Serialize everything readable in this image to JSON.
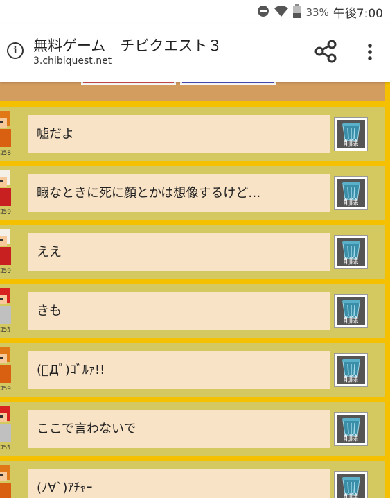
{
  "status_bar": {
    "battery": "33%",
    "time": "午後7:00"
  },
  "browser": {
    "title": "無料ゲーム　チビクエスト３",
    "url": "3.chibiquest.net"
  },
  "rows": [
    {
      "text": "嘘だよ",
      "avatar": "orange",
      "num": "ｺ58"
    },
    {
      "text": "暇なときに死に顔とかは想像するけど…",
      "avatar": "white",
      "num": "ｺ59"
    },
    {
      "text": "ええ",
      "avatar": "white",
      "num": "ｺ59"
    },
    {
      "text": "きも",
      "avatar": "red",
      "num": "ｺ5ｶ"
    },
    {
      "text": "(ﾟДﾟ)ｺﾞﾙｧ!!",
      "avatar": "orange",
      "num": "ｺ59"
    },
    {
      "text": "ここで言わないで",
      "avatar": "red",
      "num": "ｺ5ｶ"
    },
    {
      "text": "(ﾉ∀`)ｱﾁｬｰ",
      "avatar": "orange",
      "num": ""
    }
  ],
  "delete_label": "削除",
  "colors": {
    "page_bg": "#f5c000",
    "row_bg": "#d4c860",
    "msg_bg": "#f9e3c6",
    "band": "#d49d60"
  }
}
